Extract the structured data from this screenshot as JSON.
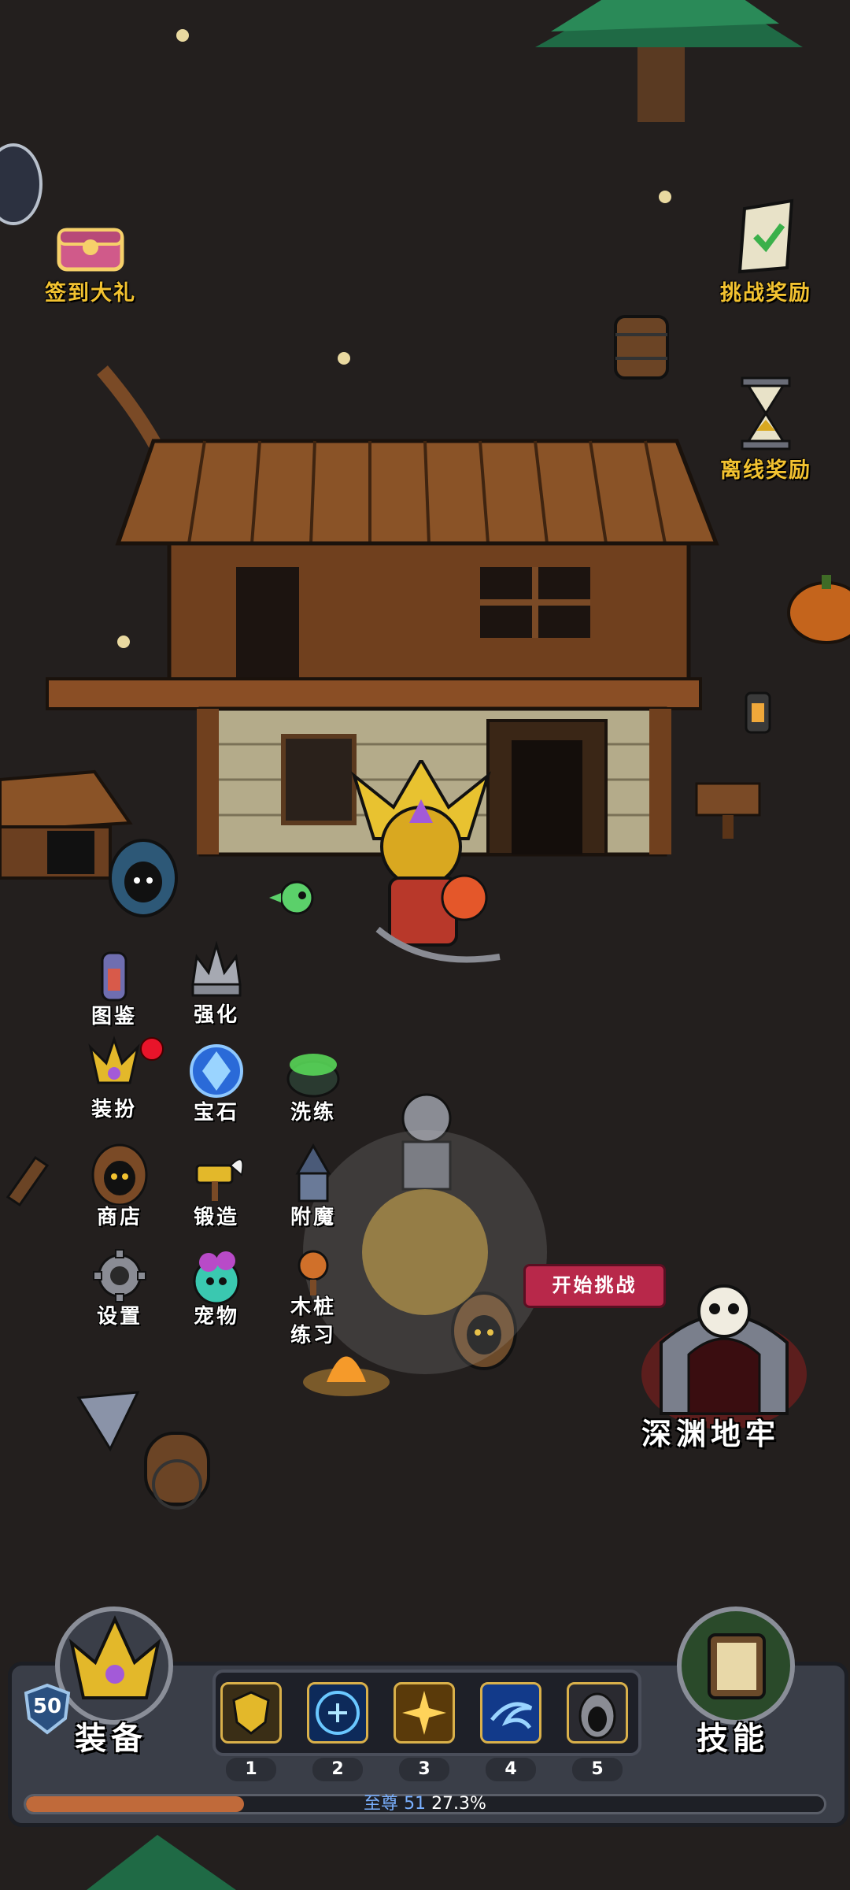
{
  "top_buttons": {
    "sign_in": "签到大礼",
    "challenge_reward": "挑战奖励",
    "offline_reward": "离线奖励"
  },
  "menu": {
    "codex": "图鉴",
    "enhance": "强化",
    "cosmetics": "装扮",
    "gem": "宝石",
    "refine": "洗练",
    "shop": "商店",
    "forge": "锻造",
    "enchant": "附魔",
    "settings": "设置",
    "pet": "宠物",
    "dummy_line1": "木桩",
    "dummy_line2": "练习"
  },
  "dungeon": {
    "start_label": "开始挑战",
    "name": "深渊地牢"
  },
  "hud": {
    "level": "50",
    "equip_label": "装备",
    "skills_label": "技能",
    "slots": [
      "1",
      "2",
      "3",
      "4",
      "5"
    ],
    "rank_name": "至尊",
    "rank_level": "51",
    "progress_text": "27.3%",
    "progress_value": 0.273
  },
  "colors": {
    "accent_gold": "#f2c230",
    "background": "#231f1e",
    "badge_red": "#e8142a",
    "progress_fill": "#c06a3a"
  }
}
